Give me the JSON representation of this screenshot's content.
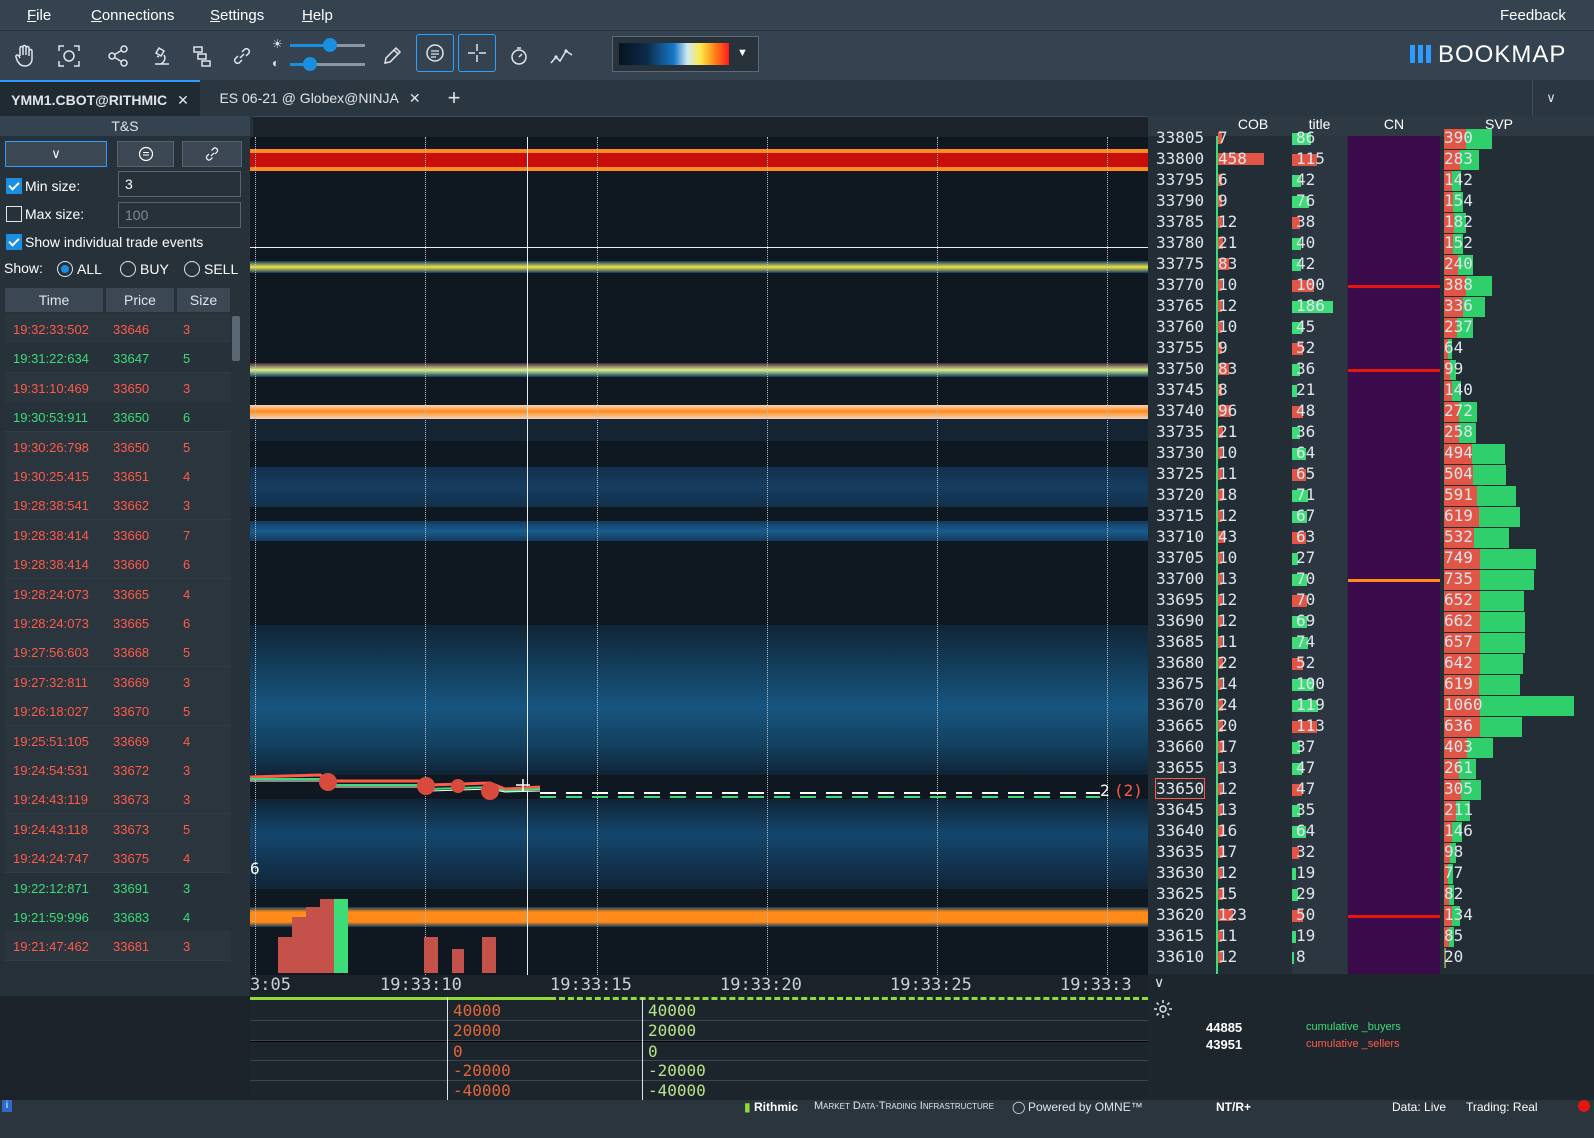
{
  "menu": {
    "file": "File",
    "connections": "Connections",
    "settings": "Settings",
    "help": "Help",
    "feedback": "Feedback"
  },
  "toolbar": {
    "icons": [
      "hand-icon",
      "crosshair-target-icon",
      "share-icon",
      "microscope-icon",
      "layers-icon",
      "link-icon",
      "brightness-icon",
      "contrast-icon",
      "pencil-icon",
      "chat-icon",
      "crosshair-icon",
      "stopwatch-icon",
      "indicator-icon"
    ],
    "brightness_level": 0.6,
    "contrast_level": 0.3,
    "logo": "BOOKMAP"
  },
  "tabs": [
    {
      "label": "YMM1.CBOT@RITHMIC",
      "active": true
    },
    {
      "label": "ES 06-21 @ Globex@NINJA",
      "active": false
    }
  ],
  "ts": {
    "title": "T&S",
    "min_size_label": "Min size:",
    "min_size_value": "3",
    "min_size_checked": true,
    "max_size_label": "Max size:",
    "max_size_placeholder": "100",
    "max_size_checked": false,
    "show_individual_label": "Show individual trade events",
    "show_label": "Show:",
    "show_options": [
      "ALL",
      "BUY",
      "SELL"
    ],
    "show_selected": "ALL",
    "columns": [
      "Time",
      "Price",
      "Size"
    ],
    "rows": [
      {
        "time": "19:32:33:502",
        "price": "33646",
        "size": "3",
        "side": "sell"
      },
      {
        "time": "19:31:22:634",
        "price": "33647",
        "size": "5",
        "side": "buy"
      },
      {
        "time": "19:31:10:469",
        "price": "33650",
        "size": "3",
        "side": "sell"
      },
      {
        "time": "19:30:53:911",
        "price": "33650",
        "size": "6",
        "side": "buy"
      },
      {
        "time": "19:30:26:798",
        "price": "33650",
        "size": "5",
        "side": "sell"
      },
      {
        "time": "19:30:25:415",
        "price": "33651",
        "size": "4",
        "side": "sell"
      },
      {
        "time": "19:28:38:541",
        "price": "33662",
        "size": "3",
        "side": "sell"
      },
      {
        "time": "19:28:38:414",
        "price": "33660",
        "size": "7",
        "side": "sell"
      },
      {
        "time": "19:28:38:414",
        "price": "33660",
        "size": "6",
        "side": "sell"
      },
      {
        "time": "19:28:24:073",
        "price": "33665",
        "size": "4",
        "side": "sell"
      },
      {
        "time": "19:28:24:073",
        "price": "33665",
        "size": "6",
        "side": "sell"
      },
      {
        "time": "19:27:56:603",
        "price": "33668",
        "size": "5",
        "side": "sell"
      },
      {
        "time": "19:27:32:811",
        "price": "33669",
        "size": "3",
        "side": "sell"
      },
      {
        "time": "19:26:18:027",
        "price": "33670",
        "size": "5",
        "side": "sell"
      },
      {
        "time": "19:25:51:105",
        "price": "33669",
        "size": "4",
        "side": "sell"
      },
      {
        "time": "19:24:54:531",
        "price": "33672",
        "size": "3",
        "side": "sell"
      },
      {
        "time": "19:24:43:119",
        "price": "33673",
        "size": "3",
        "side": "sell"
      },
      {
        "time": "19:24:43:118",
        "price": "33673",
        "size": "5",
        "side": "sell"
      },
      {
        "time": "19:24:24:747",
        "price": "33675",
        "size": "4",
        "side": "sell"
      },
      {
        "time": "19:22:12:871",
        "price": "33691",
        "size": "3",
        "side": "buy"
      },
      {
        "time": "19:21:59:996",
        "price": "33683",
        "size": "4",
        "side": "buy"
      },
      {
        "time": "19:21:47:462",
        "price": "33681",
        "size": "3",
        "side": "sell"
      }
    ]
  },
  "heatmap": {
    "time_labels": [
      "3:05",
      "19:33:10",
      "19:33:15",
      "19:33:20",
      "19:33:25",
      "19:33:3"
    ],
    "last_trade_label": "2",
    "last_trade_bracket": "(2)",
    "left_edge_label": "6"
  },
  "indicator": {
    "left_axis": [
      "40000",
      "20000",
      "0",
      "-20000",
      "-40000"
    ],
    "right_axis": [
      "40000",
      "20000",
      "0",
      "-20000",
      "-40000"
    ]
  },
  "dom": {
    "columns": [
      "COB",
      "title",
      "CN",
      "SVP"
    ],
    "rows": [
      {
        "price": "33805",
        "cob": "7",
        "title": "86",
        "svp": "390"
      },
      {
        "price": "33800",
        "cob": "458",
        "title": "115",
        "svp": "283"
      },
      {
        "price": "33795",
        "cob": "6",
        "title": "42",
        "svp": "142"
      },
      {
        "price": "33790",
        "cob": "9",
        "title": "76",
        "svp": "154"
      },
      {
        "price": "33785",
        "cob": "12",
        "title": "38",
        "svp": "182"
      },
      {
        "price": "33780",
        "cob": "21",
        "title": "40",
        "svp": "152"
      },
      {
        "price": "33775",
        "cob": "83",
        "title": "42",
        "svp": "240"
      },
      {
        "price": "33770",
        "cob": "10",
        "title": "100",
        "svp": "388"
      },
      {
        "price": "33765",
        "cob": "12",
        "title": "186",
        "svp": "336"
      },
      {
        "price": "33760",
        "cob": "10",
        "title": "45",
        "svp": "237"
      },
      {
        "price": "33755",
        "cob": "9",
        "title": "52",
        "svp": "64"
      },
      {
        "price": "33750",
        "cob": "83",
        "title": "36",
        "svp": "99"
      },
      {
        "price": "33745",
        "cob": "8",
        "title": "21",
        "svp": "140"
      },
      {
        "price": "33740",
        "cob": "96",
        "title": "48",
        "svp": "272"
      },
      {
        "price": "33735",
        "cob": "21",
        "title": "36",
        "svp": "258"
      },
      {
        "price": "33730",
        "cob": "10",
        "title": "64",
        "svp": "494"
      },
      {
        "price": "33725",
        "cob": "11",
        "title": "65",
        "svp": "504"
      },
      {
        "price": "33720",
        "cob": "18",
        "title": "71",
        "svp": "591"
      },
      {
        "price": "33715",
        "cob": "12",
        "title": "67",
        "svp": "619"
      },
      {
        "price": "33710",
        "cob": "43",
        "title": "63",
        "svp": "532"
      },
      {
        "price": "33705",
        "cob": "10",
        "title": "27",
        "svp": "749"
      },
      {
        "price": "33700",
        "cob": "13",
        "title": "70",
        "svp": "735"
      },
      {
        "price": "33695",
        "cob": "12",
        "title": "70",
        "svp": "652"
      },
      {
        "price": "33690",
        "cob": "12",
        "title": "69",
        "svp": "662"
      },
      {
        "price": "33685",
        "cob": "11",
        "title": "74",
        "svp": "657"
      },
      {
        "price": "33680",
        "cob": "22",
        "title": "52",
        "svp": "642"
      },
      {
        "price": "33675",
        "cob": "14",
        "title": "100",
        "svp": "619"
      },
      {
        "price": "33670",
        "cob": "24",
        "title": "119",
        "svp": "1060"
      },
      {
        "price": "33665",
        "cob": "20",
        "title": "113",
        "svp": "636"
      },
      {
        "price": "33660",
        "cob": "17",
        "title": "37",
        "svp": "403"
      },
      {
        "price": "33655",
        "cob": "13",
        "title": "47",
        "svp": "261"
      },
      {
        "price": "33650",
        "cob": "12",
        "title": "47",
        "svp": "305"
      },
      {
        "price": "33645",
        "cob": "13",
        "title": "35",
        "svp": "211"
      },
      {
        "price": "33640",
        "cob": "16",
        "title": "64",
        "svp": "146"
      },
      {
        "price": "33635",
        "cob": "17",
        "title": "32",
        "svp": "98"
      },
      {
        "price": "33630",
        "cob": "12",
        "title": "19",
        "svp": "77"
      },
      {
        "price": "33625",
        "cob": "15",
        "title": "29",
        "svp": "82"
      },
      {
        "price": "33620",
        "cob": "123",
        "title": "50",
        "svp": "134"
      },
      {
        "price": "33615",
        "cob": "11",
        "title": "19",
        "svp": "85"
      },
      {
        "price": "33610",
        "cob": "12",
        "title": "8",
        "svp": "20"
      }
    ],
    "current_price": "33650"
  },
  "cumulative": {
    "buyers_value": "44885",
    "sellers_value": "43951",
    "buyers_label": "cumulative _buyers",
    "sellers_label": "cumulative _sellers"
  },
  "status": {
    "rithmic": "Rithmic",
    "rithmic_tag": "Market Data·Trading Infrastructure",
    "omne": "Powered by OMNE™",
    "ntr": "NT/R+",
    "data": "Data: Live",
    "trading": "Trading: Real"
  },
  "colors": {
    "accent": "#1a8fe0",
    "sell": "#ff5a4a",
    "buy": "#3ddc78",
    "heat_orange": "#ff8c1a",
    "heat_red": "#e5150f"
  }
}
